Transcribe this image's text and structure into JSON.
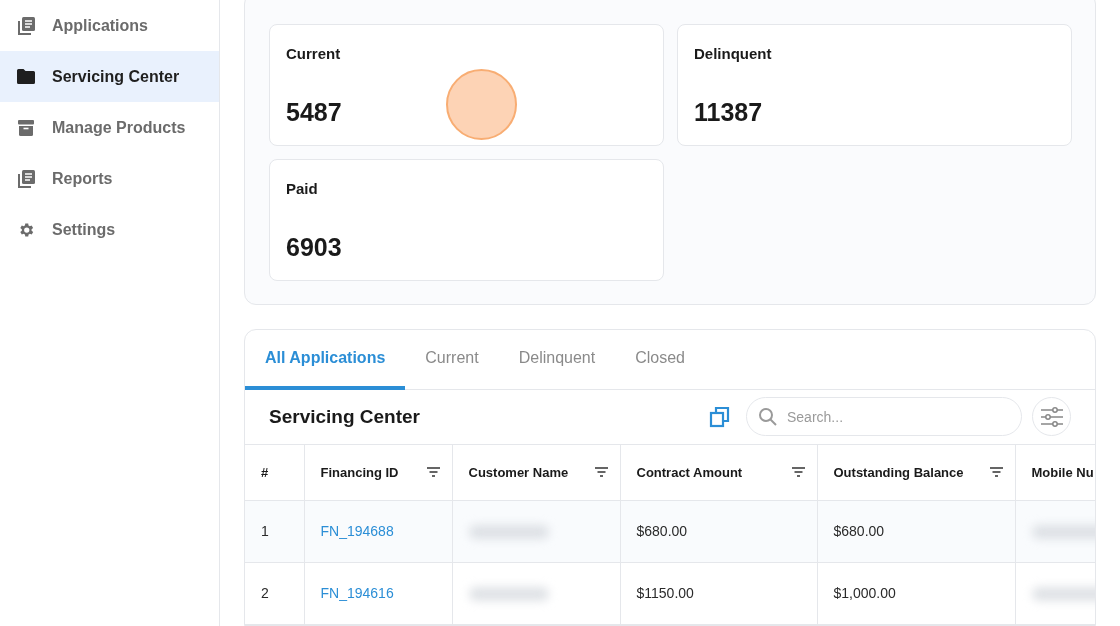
{
  "sidebar": {
    "items": [
      {
        "label": "Applications",
        "kind": "list",
        "selected": false
      },
      {
        "label": "Servicing Center",
        "kind": "folder",
        "selected": true
      },
      {
        "label": "Manage Products",
        "kind": "archive",
        "selected": false
      },
      {
        "label": "Reports",
        "kind": "list",
        "selected": false
      },
      {
        "label": "Settings",
        "kind": "gear",
        "selected": false
      }
    ]
  },
  "summary_cards": [
    {
      "label": "Current",
      "value": "5487"
    },
    {
      "label": "Delinquent",
      "value": "11387"
    },
    {
      "label": "Paid",
      "value": "6903"
    }
  ],
  "tabs": [
    {
      "label": "All Applications",
      "selected": true
    },
    {
      "label": "Current",
      "selected": false
    },
    {
      "label": "Delinquent",
      "selected": false
    },
    {
      "label": "Closed",
      "selected": false
    }
  ],
  "table_title": "Servicing Center",
  "search": {
    "placeholder": "Search..."
  },
  "table": {
    "columns": [
      {
        "label": "#",
        "filter": false
      },
      {
        "label": "Financing ID",
        "filter": true
      },
      {
        "label": "Customer Name",
        "filter": true
      },
      {
        "label": "Contract Amount",
        "filter": true
      },
      {
        "label": "Outstanding Balance",
        "filter": true
      },
      {
        "label": "Mobile Nu"
      }
    ],
    "rows": [
      {
        "index": "1",
        "financing_id": "FN_194688",
        "contract_amount": "$680.00",
        "outstanding_balance": "$680.00"
      },
      {
        "index": "2",
        "financing_id": "FN_194616",
        "contract_amount": "$1150.00",
        "outstanding_balance": "$1,000.00"
      }
    ]
  }
}
